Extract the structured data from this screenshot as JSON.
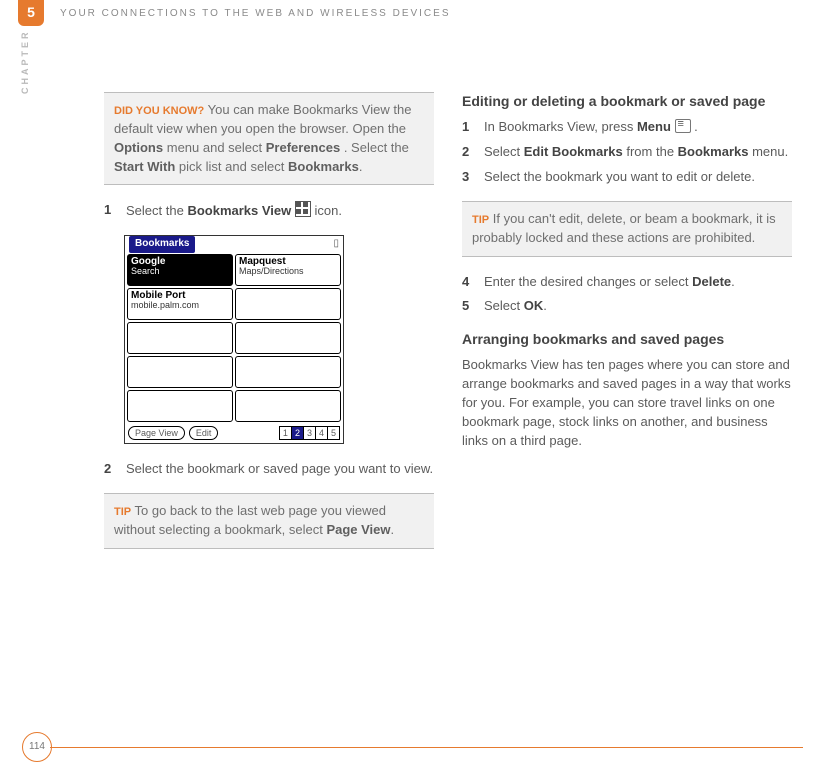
{
  "header": {
    "chapter_number": "5",
    "chapter_label": "CHAPTER",
    "running_head": "YOUR CONNECTIONS TO THE WEB AND WIRELESS DEVICES"
  },
  "left": {
    "dyk": {
      "tag": "DID YOU KNOW?",
      "p1": " You can make Bookmarks View the default view when you open the browser. Open the ",
      "b1": "Options",
      "p2": " menu and select ",
      "b2": "Preferences",
      "p3": ". Select the ",
      "b3": "Start With",
      "p4": " pick list and select ",
      "b4": "Bookmarks"
    },
    "steps": [
      {
        "num": "1",
        "pre": "Select the ",
        "bold": "Bookmarks View ",
        "post": " icon."
      },
      {
        "num": "2",
        "text": "Select the bookmark or saved page you want to view."
      }
    ],
    "device": {
      "title": "Bookmarks",
      "cells": [
        {
          "title": "Google",
          "sub": "Search"
        },
        {
          "title": "Mapquest",
          "sub": "Maps/Directions"
        },
        {
          "title": "Mobile Port",
          "sub": "mobile.palm.com"
        }
      ],
      "footer": {
        "btn1": "Page View",
        "btn2": "Edit",
        "pages": [
          "1",
          "2",
          "3",
          "4",
          "5"
        ]
      }
    },
    "tip": {
      "tag": "TIP",
      "text": " To go back to the last web page you viewed without selecting a bookmark, select ",
      "bold": "Page View"
    }
  },
  "right": {
    "h1": "Editing or deleting a bookmark or saved page",
    "steps": [
      {
        "num": "1",
        "pre": "In Bookmarks View, press ",
        "bold": "Menu "
      },
      {
        "num": "2",
        "pre": "Select ",
        "bold": "Edit Bookmarks",
        "mid": " from the ",
        "bold2": "Bookmarks",
        "post": " menu."
      },
      {
        "num": "3",
        "text": "Select the bookmark you want to edit or delete."
      },
      {
        "num": "4",
        "pre": "Enter the desired changes or select ",
        "bold": "Delete"
      },
      {
        "num": "5",
        "pre": "Select ",
        "bold": "OK"
      }
    ],
    "tip": {
      "tag": "TIP",
      "text": " If you can't edit, delete, or beam a bookmark, it is probably locked and these actions are prohibited."
    },
    "h2": "Arranging bookmarks and saved pages",
    "body": "Bookmarks View has ten pages where you can store and arrange bookmarks and saved pages in a way that works for you. For example, you can store travel links on one bookmark page, stock links on another, and business links on a third page."
  },
  "footer": {
    "page": "114"
  }
}
